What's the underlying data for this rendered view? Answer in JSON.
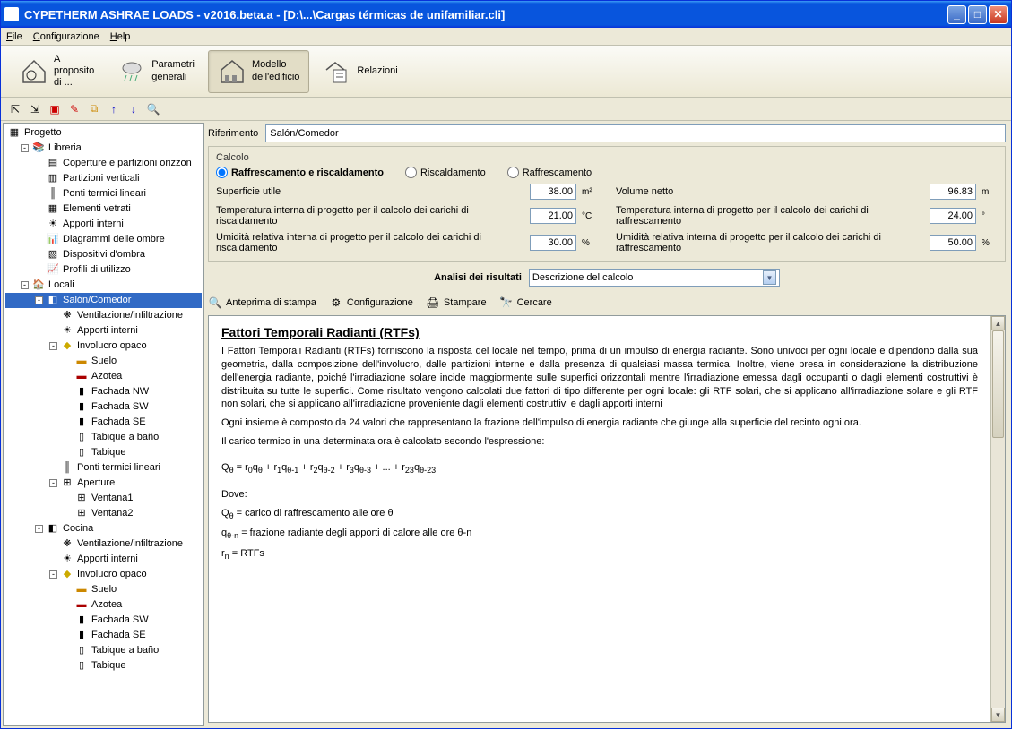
{
  "window": {
    "title": "CYPETHERM ASHRAE LOADS - v2016.beta.a - [D:\\...\\Cargas térmicas de unifamiliar.cli]"
  },
  "menu": {
    "file": "File",
    "config": "Configurazione",
    "help": "Help"
  },
  "ribbon": {
    "about": "A\nproposito\ndi ...",
    "params": "Parametri\ngenerali",
    "model": "Modello\ndell'edificio",
    "reports": "Relazioni"
  },
  "ref": {
    "label": "Riferimento",
    "value": "Salón/Comedor"
  },
  "calc": {
    "title": "Calcolo",
    "opt_both": "Raffrescamento e riscaldamento",
    "opt_heat": "Riscaldamento",
    "opt_cool": "Raffrescamento",
    "surface_label": "Superficie utile",
    "surface_val": "38.00",
    "surface_unit": "m²",
    "volume_label": "Volume netto",
    "volume_val": "96.83",
    "volume_unit": "m",
    "t_heat_label": "Temperatura interna di progetto per il calcolo dei carichi di riscaldamento",
    "t_heat_val": "21.00",
    "t_heat_unit": "°C",
    "t_cool_label": "Temperatura interna di progetto per il calcolo dei carichi di raffrescamento",
    "t_cool_val": "24.00",
    "h_heat_label": "Umidità relativa interna di progetto per il calcolo dei carichi di riscaldamento",
    "h_heat_val": "30.00",
    "h_heat_unit": "%",
    "h_cool_label": "Umidità relativa interna di progetto per il calcolo dei carichi di raffrescamento",
    "h_cool_val": "50.00"
  },
  "analysis": {
    "label": "Analisi dei risultati",
    "value": "Descrizione del calcolo"
  },
  "actions": {
    "print": "Anteprima di stampa",
    "config": "Configurazione",
    "stamp": "Stampare",
    "search": "Cercare"
  },
  "doc": {
    "h": "Fattori Temporali Radianti (RTFs)",
    "p1": "I Fattori Temporali Radianti (RTFs) forniscono la risposta del locale nel tempo, prima di un impulso di energia radiante. Sono univoci per ogni locale e dipendono dalla sua geometria, dalla composizione dell'involucro, dalle partizioni interne e dalla presenza di qualsiasi massa termica. Inoltre, viene presa in considerazione la distribuzione dell'energia radiante, poiché l'irradiazione solare incide maggiormente sulle superfici orizzontali mentre l'irradiazione emessa dagli occupanti o dagli elementi costruttivi è distribuita su tutte le superfici. Come risultato vengono calcolati due fattori di tipo differente per ogni locale: gli RTF solari, che si applicano all'irradiazione solare e gli RTF non solari, che si applicano all'irradiazione proveniente dagli elementi costruttivi e dagli apporti interni",
    "p2": "Ogni insieme è composto da 24 valori che rappresentano la frazione dell'impulso di energia radiante che giunge alla superficie del recinto ogni ora.",
    "p3": "Il carico termico in una determinata ora è calcolato secondo l'espressione:",
    "eq": "Qθ = r0qθ + r1qθ-1 + r2qθ-2 + r3qθ-3 + ... + r23qθ-23",
    "p4": "Dove:",
    "d1": "Qθ = carico di raffrescamento alle ore θ",
    "d2": "qθ-n = frazione radiante degli apporti di calore alle ore θ-n",
    "d3": "rn = RTFs"
  },
  "tree": {
    "root": "Progetto",
    "lib": "Libreria",
    "lib_items": [
      "Coperture e partizioni orizzon",
      "Partizioni verticali",
      "Ponti termici lineari",
      "Elementi vetrati",
      "Apporti interni",
      "Diagrammi delle ombre",
      "Dispositivi d'ombra",
      "Profili di utilizzo"
    ],
    "locali": "Locali",
    "room1": "Salón/Comedor",
    "room1_items": [
      "Ventilazione/infiltrazione",
      "Apporti interni"
    ],
    "inv_opaco": "Involucro opaco",
    "inv_items": [
      "Suelo",
      "Azotea",
      "Fachada NW",
      "Fachada SW",
      "Fachada SE",
      "Tabique a baño",
      "Tabique"
    ],
    "ponti": "Ponti termici lineari",
    "aperture": "Aperture",
    "ap_items": [
      "Ventana1",
      "Ventana2"
    ],
    "room2": "Cocina",
    "room2_items": [
      "Ventilazione/infiltrazione",
      "Apporti interni"
    ],
    "inv2_items": [
      "Suelo",
      "Azotea",
      "Fachada SW",
      "Fachada SE",
      "Tabique a baño",
      "Tabique"
    ]
  }
}
